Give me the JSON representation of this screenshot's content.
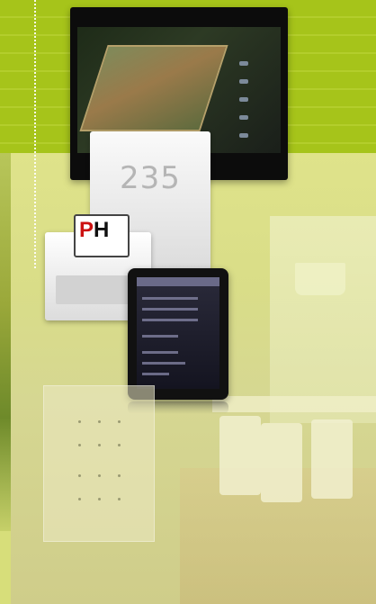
{
  "keypad": {
    "display_number": "235"
  },
  "key_card": {
    "logo_text_p": "P",
    "logo_text_h": "H"
  },
  "colors": {
    "brand_green": "#a6c41a",
    "background_lime": "#d7de7a",
    "device_black": "#0c0c0c",
    "panel_white": "#fafafa",
    "logo_red": "#cc1111"
  }
}
